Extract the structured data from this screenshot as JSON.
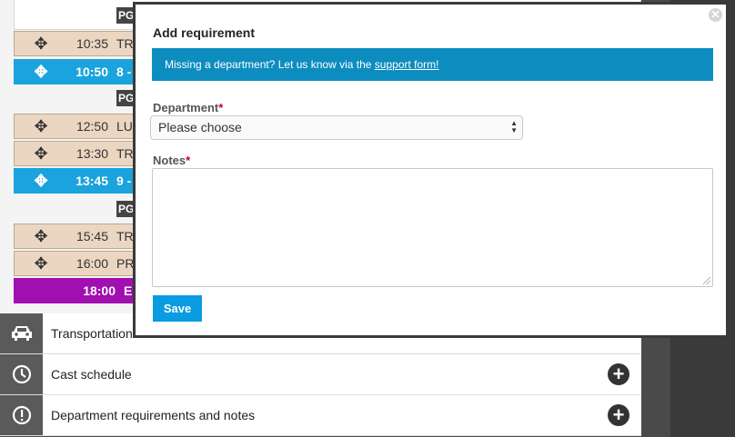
{
  "schedule": {
    "rows": [
      {
        "time": "10:35",
        "title": "TR",
        "style": "tan"
      },
      {
        "time": "10:50",
        "title": "8 -",
        "style": "blue"
      },
      {
        "time": "12:50",
        "title": "LU",
        "style": "tan"
      },
      {
        "time": "13:30",
        "title": "TR",
        "style": "tan"
      },
      {
        "time": "13:45",
        "title": "9 -",
        "style": "blue"
      },
      {
        "time": "15:45",
        "title": "TR",
        "style": "tan"
      },
      {
        "time": "16:00",
        "title": "PR",
        "style": "tan"
      },
      {
        "time": "18:00",
        "title": "EI",
        "style": "purple"
      }
    ],
    "pg_label": "PG",
    "move_glyph": "✥"
  },
  "sections": [
    {
      "label": "Transportation",
      "icon": "car-icon"
    },
    {
      "label": "Cast schedule",
      "icon": "clock-icon"
    },
    {
      "label": "Department requirements and notes",
      "icon": "exclamation-icon"
    }
  ],
  "modal": {
    "title": "Add requirement",
    "alert_text": "Missing a department? Let us know via the ",
    "alert_link": "support form!",
    "department_label": "Department",
    "department_value": "Please choose",
    "notes_label": "Notes",
    "notes_value": "",
    "required_mark": "*",
    "save_label": "Save",
    "close_glyph": "✕"
  }
}
